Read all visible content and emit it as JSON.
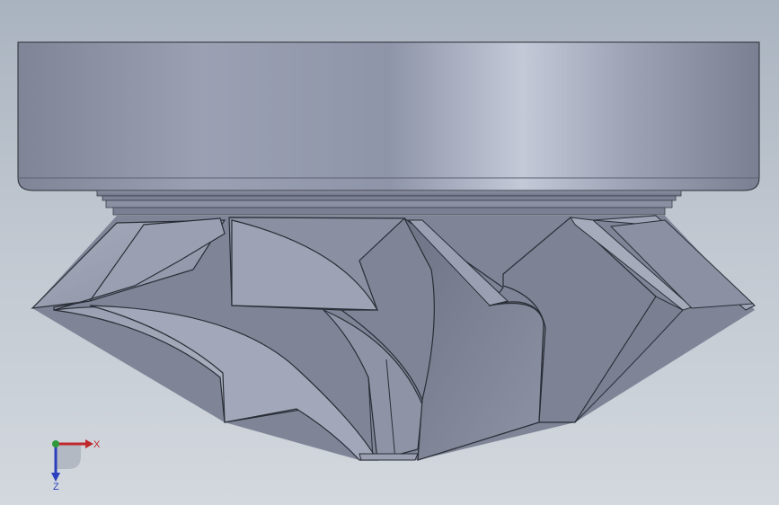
{
  "viewport": {
    "model": "impeller",
    "background_top": "#a9b3bf",
    "background_bottom": "#d3d8de"
  },
  "triad": {
    "x_label": "X",
    "z_label": "Z",
    "x_color": "#c0282d",
    "y_color": "#2e9a3a",
    "z_color": "#2b3fbf"
  }
}
